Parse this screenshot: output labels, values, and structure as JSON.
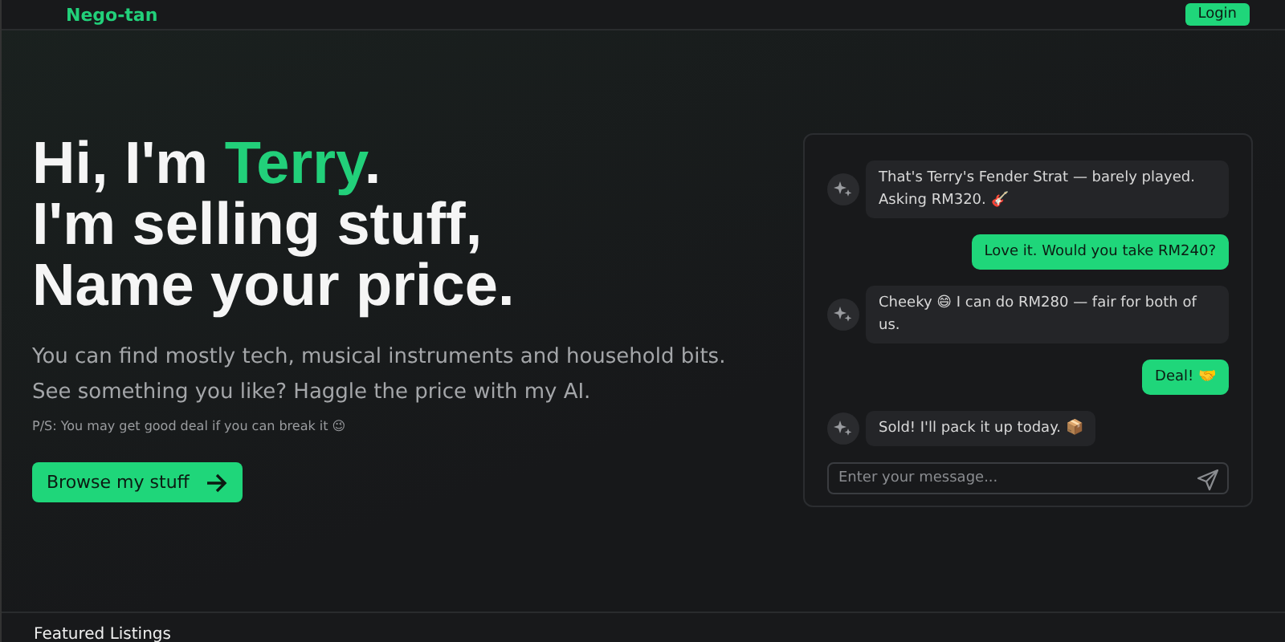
{
  "header": {
    "logo": "Nego-tan",
    "login": "Login"
  },
  "hero": {
    "line1_prefix": "Hi, I'm ",
    "name": "Terry",
    "line1_suffix": ".",
    "line2": "I'm selling stuff,",
    "line3": "Name your price.",
    "description": [
      "You can find mostly tech, musical instruments and household bits.",
      "See something you like? Haggle the price with my AI."
    ],
    "note": "P/S: You may get good deal if you can break it 😉",
    "cta": "Browse my stuff"
  },
  "chat": {
    "messages": [
      {
        "kind": "bot",
        "text": "That's Terry's Fender Strat — barely played. Asking RM320. 🎸"
      },
      {
        "kind": "user",
        "text": "Love it. Would you take RM240?"
      },
      {
        "kind": "bot",
        "text": "Cheeky 😄 I can do RM280 — fair for both of us."
      },
      {
        "kind": "user",
        "text": "Deal! 🤝"
      },
      {
        "kind": "bot",
        "text": "Sold! I'll pack it up today. 📦"
      }
    ],
    "placeholder": "Enter your message..."
  },
  "section_title": "Featured Listings"
}
